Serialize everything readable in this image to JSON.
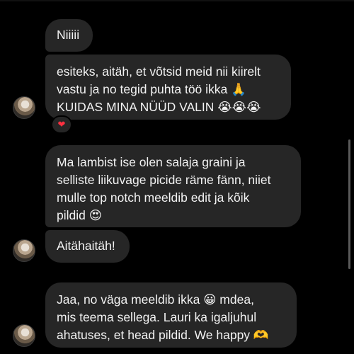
{
  "messages": [
    {
      "text": "Niiiii"
    },
    {
      "text": "esiteks, aitäh, et võtsid meid nii kiirelt\nvastu ja no tegid puhta töö ikka 🙏\nKUIDAS MINA NÜÜD VALIN 😭😭😭"
    },
    {
      "text": "Ma lambist ise olen salaja graini ja\nselliste liikuvage picide räme fänn, niiet\nmulle top notch meeldib edit ja kõik\npildid 😍"
    },
    {
      "text": "Aitähaitäh!"
    },
    {
      "text": "Jaa, no väga meeldib ikka 😀 mdea,\nmis teema sellega. Lauri ka igaljuhul\nahatuses, et head pildid. We happy 🫶"
    }
  ],
  "reaction": {
    "emoji": "❤"
  },
  "icons": {
    "reaction": "heart-icon",
    "avatar": "avatar"
  },
  "colors": {
    "bubble": "#262626",
    "background": "#000000",
    "reaction": "#ff3040"
  }
}
